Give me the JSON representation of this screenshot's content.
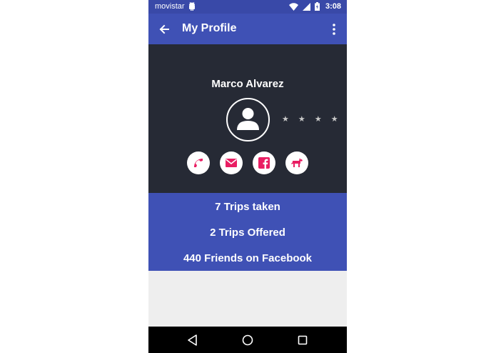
{
  "status_bar": {
    "carrier": "movistar",
    "time": "3:08",
    "icons": [
      "android-icon",
      "wifi-icon",
      "signal-icon",
      "battery-icon"
    ]
  },
  "app_bar": {
    "title": "My Profile",
    "back_icon": "arrow-back-icon",
    "menu_icon": "more-vert-icon"
  },
  "profile": {
    "name": "Marco Alvarez",
    "avatar_icon": "person-icon",
    "rating_display": "★ ★ ★ ★",
    "rating": 4,
    "contacts": [
      {
        "name": "phone",
        "icon": "phone-icon"
      },
      {
        "name": "email",
        "icon": "mail-icon"
      },
      {
        "name": "facebook",
        "icon": "facebook-icon"
      },
      {
        "name": "pet",
        "icon": "dog-icon"
      }
    ]
  },
  "stats": {
    "trips_taken": "7 Trips taken",
    "trips_offered": "2 Trips Offered",
    "friends": "440 Friends on Facebook"
  },
  "nav_bar": {
    "buttons": [
      "back-triangle-icon",
      "home-circle-icon",
      "recents-square-icon"
    ]
  },
  "colors": {
    "primary": "#3f51b5",
    "primary_dark": "#3949a8",
    "profile_bg": "#262a35",
    "accent": "#e91e63",
    "background": "#eeeeee"
  }
}
